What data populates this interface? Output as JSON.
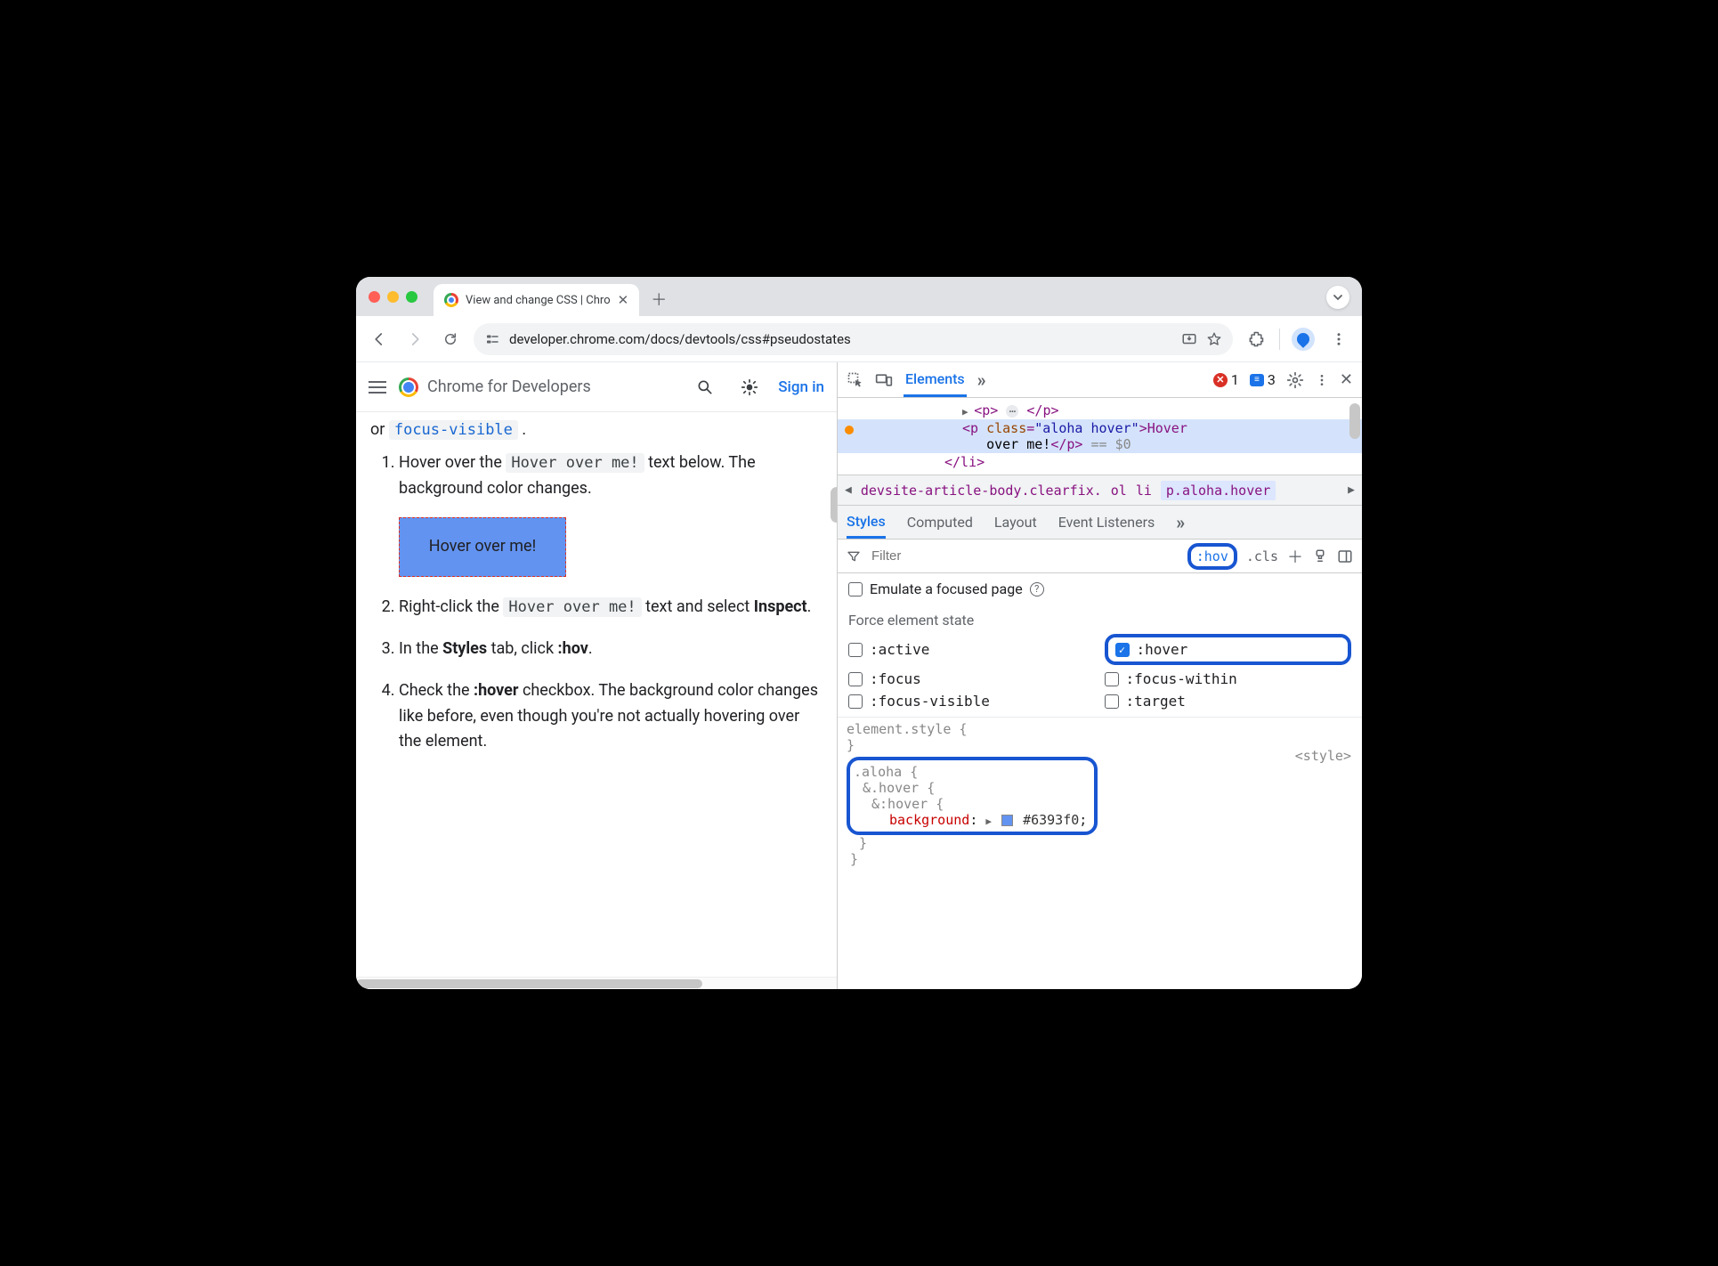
{
  "tab": {
    "title": "View and change CSS  |  Chro"
  },
  "url": "developer.chrome.com/docs/devtools/css#pseudostates",
  "page": {
    "brand": "Chrome for Developers",
    "sign_in": "Sign in",
    "intro_or": "or ",
    "intro_code": "focus-visible",
    "step1_a": "Hover over the ",
    "step1_code": "Hover over me!",
    "step1_b": " text below. The background color changes.",
    "hover_box": "Hover over me!",
    "step2_a": "Right-click the ",
    "step2_code": "Hover over me!",
    "step2_b": " text and select ",
    "step2_bold": "Inspect",
    "step3_a": "In the ",
    "step3_bold1": "Styles",
    "step3_b": " tab, click ",
    "step3_bold2": ":hov",
    "step4_a": "Check the ",
    "step4_bold": ":hover",
    "step4_b": " checkbox. The background color changes like before, even though you're not actually hovering over the element."
  },
  "devtools": {
    "top_tab": "Elements",
    "errors": "1",
    "messages": "3",
    "dom": {
      "l1_pre": "▶ ",
      "l1_open": "<p>",
      "l1_close": "</p>",
      "l2_open": "<p ",
      "l2_attrn": "class",
      "l2_attrv": "\"aloha hover\"",
      "l2_txt1": ">Hover",
      "l3_txt": "over me!",
      "l3_close": "</p>",
      "l3_eq": " == $0",
      "l4": "</li>"
    },
    "crumbs": {
      "c1": "devsite-article-body.clearfix.",
      "c2": "ol",
      "c3": "li",
      "c4": "p.aloha.hover"
    },
    "subtabs": {
      "styles": "Styles",
      "computed": "Computed",
      "layout": "Layout",
      "ev": "Event Listeners"
    },
    "filter": {
      "placeholder": "Filter",
      "hov": ":hov",
      "cls": ".cls"
    },
    "emulate": "Emulate a focused page",
    "force_title": "Force element state",
    "states": {
      "active": ":active",
      "hover": ":hover",
      "focus": ":focus",
      "focus_within": ":focus-within",
      "focus_visible": ":focus-visible",
      "target": ":target"
    },
    "rules": {
      "el_style": "element.style {",
      "close": "}",
      "src": "<style>",
      "sel1": ".aloha {",
      "sel2": "&.hover {",
      "sel3": "&:hover {",
      "prop": "background",
      "val": "#6393f0"
    }
  }
}
